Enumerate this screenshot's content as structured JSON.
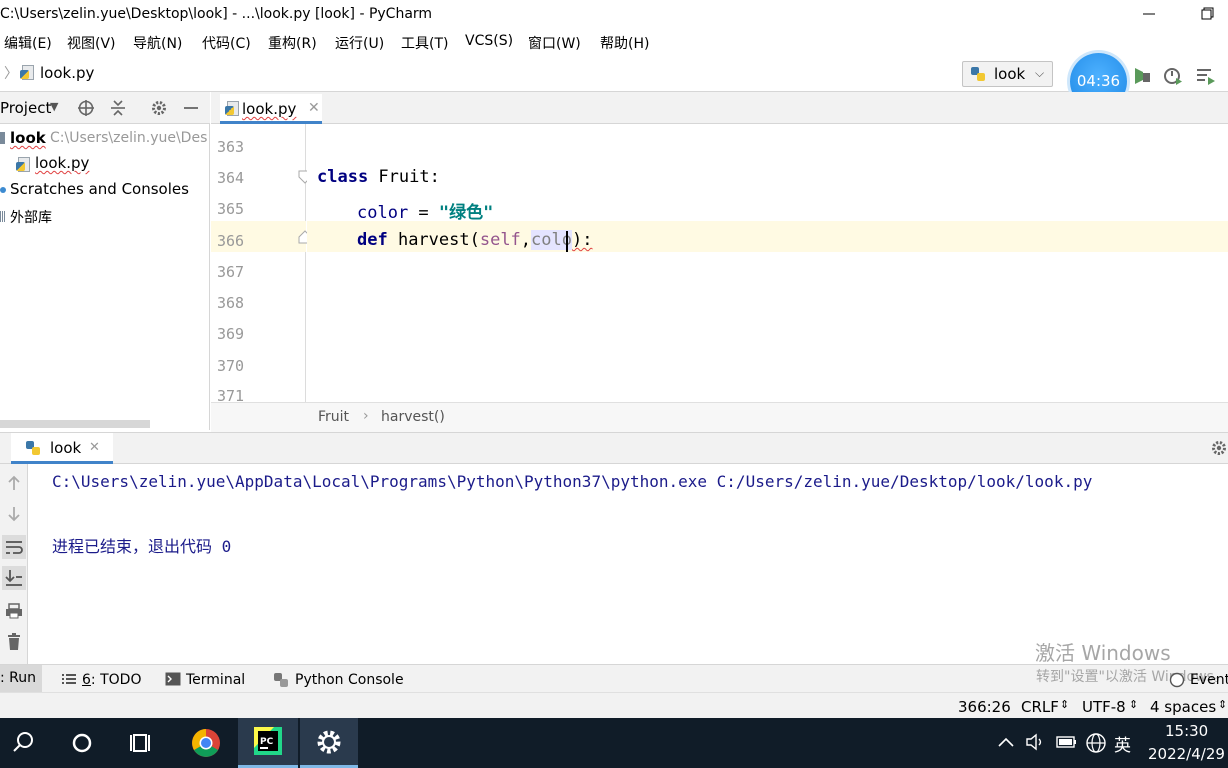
{
  "window": {
    "title": "C:\\Users\\zelin.yue\\Desktop\\look] - ...\\look.py [look] - PyCharm"
  },
  "menu": [
    "编辑(E)",
    "视图(V)",
    "导航(N)",
    "代码(C)",
    "重构(R)",
    "运行(U)",
    "工具(T)",
    "VCS(S)",
    "窗口(W)",
    "帮助(H)"
  ],
  "navbar": {
    "file": "look.py",
    "run_config": "look",
    "timer": "04:36"
  },
  "project": {
    "header": "Project",
    "root_name": "look",
    "root_path": "C:\\Users\\zelin.yue\\Des",
    "file": "look.py",
    "scratches": "Scratches and Consoles",
    "external": "外部库"
  },
  "editor": {
    "tab": "look.py",
    "line_numbers": [
      "363",
      "364",
      "365",
      "366",
      "367",
      "368",
      "369",
      "370",
      "371"
    ],
    "code": {
      "l364_kw": "class",
      "l364_name": " Fruit:",
      "l365_var": "color",
      "l365_eq": " = ",
      "l365_str": "\"绿色\"",
      "l366_kw": "def",
      "l366_name": " harvest(",
      "l366_self": "self",
      "l366_comma": ",",
      "l366_param": "colo",
      "l366_end": "):"
    },
    "breadcrumb": [
      "Fruit",
      "harvest()"
    ]
  },
  "run": {
    "tab": "look",
    "console": [
      "C:\\Users\\zelin.yue\\AppData\\Local\\Programs\\Python\\Python37\\python.exe C:/Users/zelin.yue/Desktop/look/look.py",
      "进程已结束，退出代码 0"
    ]
  },
  "bottom_tools": {
    "run": ": Run",
    "todo_num": "6",
    "todo": ": TODO",
    "terminal": "Terminal",
    "python_console": "Python Console",
    "event": "Event"
  },
  "status": {
    "position": "366:26",
    "line_sep": "CRLF",
    "encoding": "UTF-8",
    "indent": "4 spaces"
  },
  "watermark": {
    "line1": "激活 Windows",
    "line2": "转到\"设置\"以激活 Windows。"
  },
  "taskbar": {
    "ime": "英",
    "time": "15:30",
    "date": "2022/4/29"
  },
  "colors": {
    "accent": "#4083c9",
    "keyword": "#000080",
    "string": "#008080",
    "self": "#94558d",
    "current_line": "#fffae3",
    "taskbar": "#101c28"
  }
}
